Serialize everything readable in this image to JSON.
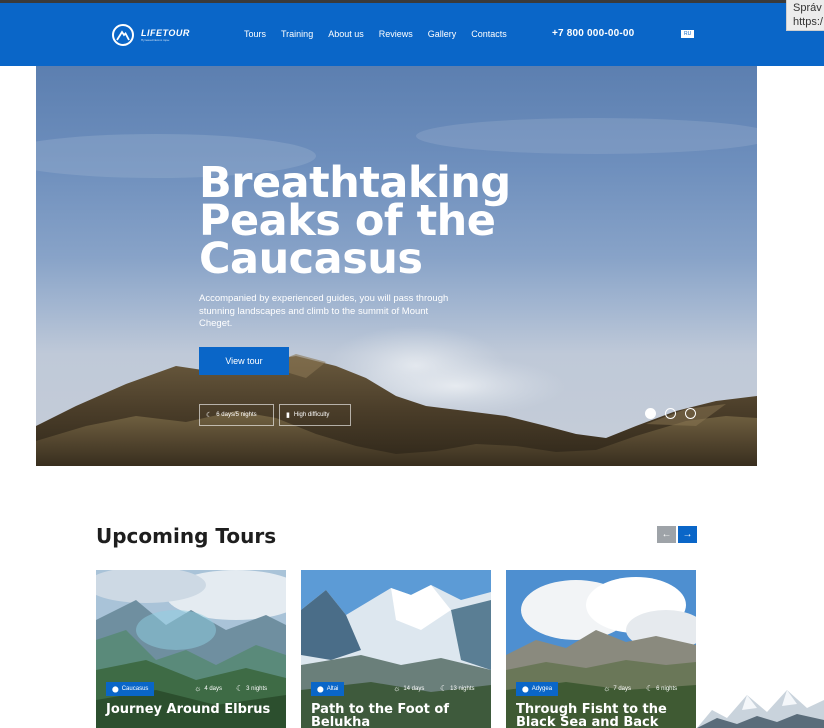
{
  "header": {
    "logo_name": "LIFETOUR",
    "logo_tagline": "Путешествия в горы",
    "nav": [
      "Tours",
      "Training",
      "About us",
      "Reviews",
      "Gallery",
      "Contacts"
    ],
    "phone": "+7 800 000-00-00",
    "lang": "RU"
  },
  "browser_tooltip": {
    "line1": "Správ",
    "line2": "https:/"
  },
  "hero": {
    "title": "Breathtaking Peaks of the Caucasus",
    "description": "Accompanied by experienced guides, you will pass through stunning landscapes and climb to the summit of Mount Cheget.",
    "button": "View tour",
    "duration": "6 days/5 nights",
    "difficulty": "High difficulty",
    "slides": 3,
    "active_slide": 1
  },
  "section": {
    "title": "Upcoming Tours",
    "prev_icon": "←",
    "next_icon": "→"
  },
  "tours": [
    {
      "region": "Caucasus",
      "days": "4 days",
      "nights": "3 nights",
      "title": "Journey Around Elbrus"
    },
    {
      "region": "Altai",
      "days": "14 days",
      "nights": "13 nights",
      "title": "Path to the Foot of Belukha"
    },
    {
      "region": "Adygea",
      "days": "7 days",
      "nights": "6 nights",
      "title": "Through Fisht to the Black Sea and Back"
    }
  ],
  "colors": {
    "brand": "#0a66c8",
    "arrow_inactive": "#9ea3a8"
  }
}
